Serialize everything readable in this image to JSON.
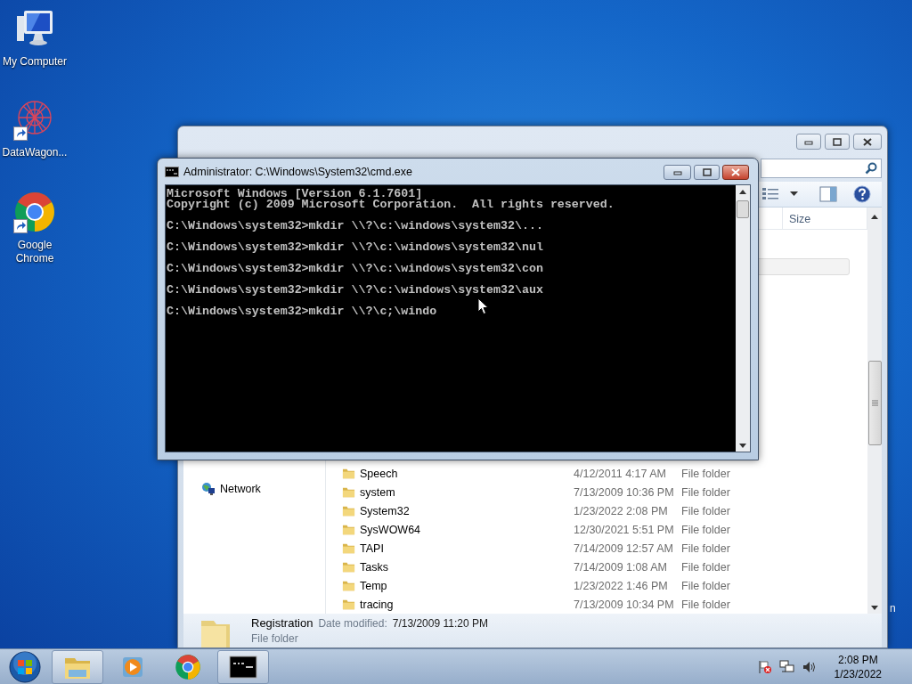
{
  "desktop_icons": [
    {
      "label": "My Computer",
      "kind": "computer",
      "shortcut": false
    },
    {
      "label": "DataWagon...",
      "kind": "datawagon",
      "shortcut": true
    },
    {
      "label": "Google Chrome",
      "kind": "chrome",
      "shortcut": true
    }
  ],
  "explorer": {
    "columns": [
      {
        "label": "Size"
      }
    ],
    "nav": [
      {
        "label": "Network"
      }
    ],
    "rows": [
      {
        "name": "Speech",
        "date": "4/12/2011 4:17 AM",
        "type": "File folder"
      },
      {
        "name": "system",
        "date": "7/13/2009 10:36 PM",
        "type": "File folder"
      },
      {
        "name": "System32",
        "date": "1/23/2022 2:08 PM",
        "type": "File folder"
      },
      {
        "name": "SysWOW64",
        "date": "12/30/2021 5:51 PM",
        "type": "File folder"
      },
      {
        "name": "TAPI",
        "date": "7/14/2009 12:57 AM",
        "type": "File folder"
      },
      {
        "name": "Tasks",
        "date": "7/14/2009 1:08 AM",
        "type": "File folder"
      },
      {
        "name": "Temp",
        "date": "1/23/2022 1:46 PM",
        "type": "File folder"
      },
      {
        "name": "tracing",
        "date": "7/13/2009 10:34 PM",
        "type": "File folder"
      }
    ],
    "details": {
      "name": "Registration",
      "date_label": "Date modified:",
      "date": "7/13/2009 11:20 PM",
      "type": "File folder"
    }
  },
  "cmd": {
    "title": "Administrator: C:\\Windows\\System32\\cmd.exe",
    "blocks": [
      [
        "Microsoft Windows [Version 6.1.7601]",
        "Copyright (c) 2009 Microsoft Corporation.  All rights reserved."
      ],
      [
        "C:\\Windows\\system32>mkdir \\\\?\\c:\\windows\\system32\\..."
      ],
      [
        "C:\\Windows\\system32>mkdir \\\\?\\c:\\windows\\system32\\nul"
      ],
      [
        "C:\\Windows\\system32>mkdir \\\\?\\c:\\windows\\system32\\con"
      ],
      [
        "C:\\Windows\\system32>mkdir \\\\?\\c:\\windows\\system32\\aux"
      ],
      [
        "C:\\Windows\\system32>mkdir \\\\?\\c;\\windo"
      ]
    ]
  },
  "edge_text": "n",
  "taskbar": {
    "buttons": [
      {
        "kind": "explorer",
        "running": true
      },
      {
        "kind": "media",
        "running": false
      },
      {
        "kind": "chrome",
        "running": false
      },
      {
        "kind": "cmd",
        "running": true
      }
    ],
    "clock": {
      "time": "2:08 PM",
      "date": "1/23/2022"
    }
  }
}
